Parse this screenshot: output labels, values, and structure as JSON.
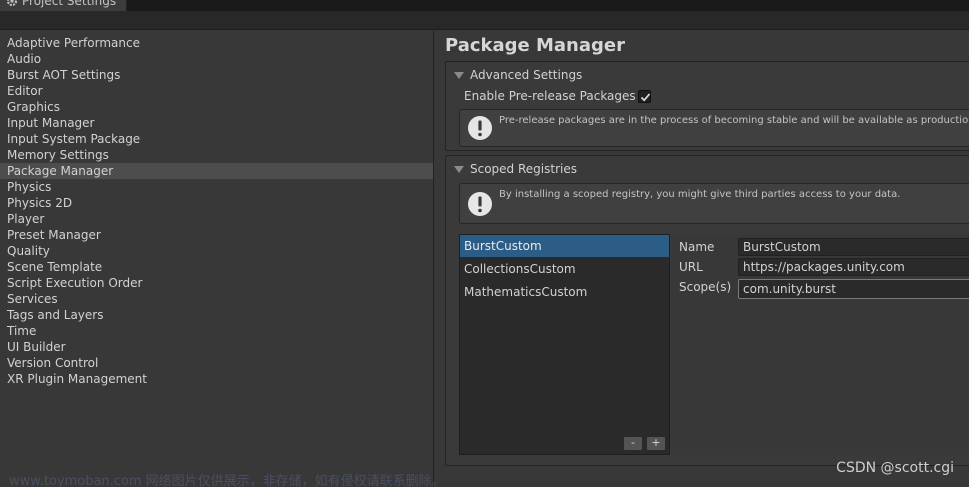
{
  "window": {
    "tab_title": "Project Settings"
  },
  "sidebar": {
    "items": [
      {
        "label": "Adaptive Performance"
      },
      {
        "label": "Audio"
      },
      {
        "label": "Burst AOT Settings"
      },
      {
        "label": "Editor"
      },
      {
        "label": "Graphics"
      },
      {
        "label": "Input Manager"
      },
      {
        "label": "Input System Package"
      },
      {
        "label": "Memory Settings"
      },
      {
        "label": "Package Manager",
        "selected": true
      },
      {
        "label": "Physics"
      },
      {
        "label": "Physics 2D"
      },
      {
        "label": "Player"
      },
      {
        "label": "Preset Manager"
      },
      {
        "label": "Quality"
      },
      {
        "label": "Scene Template"
      },
      {
        "label": "Script Execution Order"
      },
      {
        "label": "Services"
      },
      {
        "label": "Tags and Layers"
      },
      {
        "label": "Time"
      },
      {
        "label": "UI Builder"
      },
      {
        "label": "Version Control"
      },
      {
        "label": "XR Plugin Management"
      }
    ]
  },
  "main": {
    "title": "Package Manager",
    "advanced": {
      "header": "Advanced Settings",
      "prerelease_label": "Enable Pre-release Packages",
      "prerelease_checked": true,
      "help_text": "Pre-release packages are in the process of becoming stable and will be available as production-rea"
    },
    "scoped": {
      "header": "Scoped Registries",
      "help_text": "By installing a scoped registry, you might give third parties access to your data.",
      "registries": [
        {
          "label": "BurstCustom",
          "selected": true
        },
        {
          "label": "CollectionsCustom"
        },
        {
          "label": "MathematicsCustom"
        }
      ],
      "remove_label": "-",
      "add_label": "+",
      "fields": {
        "name_label": "Name",
        "name_value": "BurstCustom",
        "url_label": "URL",
        "url_value": "https://packages.unity.com",
        "scope_label": "Scope(s)",
        "scope_value": "com.unity.burst"
      }
    }
  },
  "watermark": {
    "left": "www.toymoban.com 网络图片仅供展示，非存储，如有侵权请联系删除。",
    "right": "CSDN @scott.cgi"
  },
  "colors": {
    "selection": "#2c5d87",
    "sidebar_selected": "#4d4d4d",
    "background": "#383838"
  }
}
